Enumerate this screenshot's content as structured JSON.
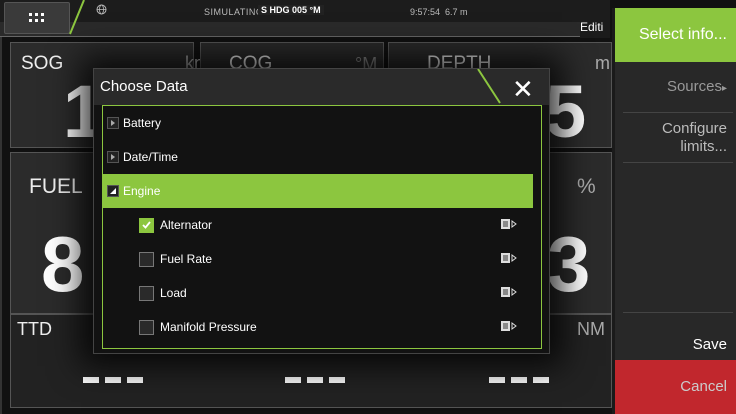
{
  "topbar": {
    "status": "SIMULATING...",
    "heading": "S HDG 005 °M",
    "time": "9:57:54",
    "range": "6.7 m",
    "edit_label": "Editi"
  },
  "panels": {
    "sog": {
      "label": "SOG",
      "unit": "kn",
      "value": "1"
    },
    "cog": {
      "label": "COG",
      "unit": "°M"
    },
    "depth": {
      "label": "DEPTH",
      "unit": "m",
      "value": "5"
    },
    "fuel": {
      "label": "FUEL",
      "value": "8"
    },
    "fuel2": {
      "unit": "%",
      "value": "3"
    },
    "ttd": {
      "label": "TTD",
      "unit": "NM"
    }
  },
  "sidebar": {
    "select_info": "Select info...",
    "sources": "Sources",
    "configure": "Configure limits...",
    "save": "Save",
    "cancel": "Cancel"
  },
  "dialog": {
    "title": "Choose Data",
    "categories": [
      {
        "label": "Battery",
        "expanded": false
      },
      {
        "label": "Date/Time",
        "expanded": false
      },
      {
        "label": "Engine",
        "expanded": true
      }
    ],
    "items": [
      {
        "label": "Alternator",
        "checked": true
      },
      {
        "label": "Fuel Rate",
        "checked": false
      },
      {
        "label": "Load",
        "checked": false
      },
      {
        "label": "Manifold Pressure",
        "checked": false
      }
    ]
  },
  "colors": {
    "accent": "#8cc63f",
    "cancel": "#c1272d",
    "panel": "#2b2b2b"
  }
}
